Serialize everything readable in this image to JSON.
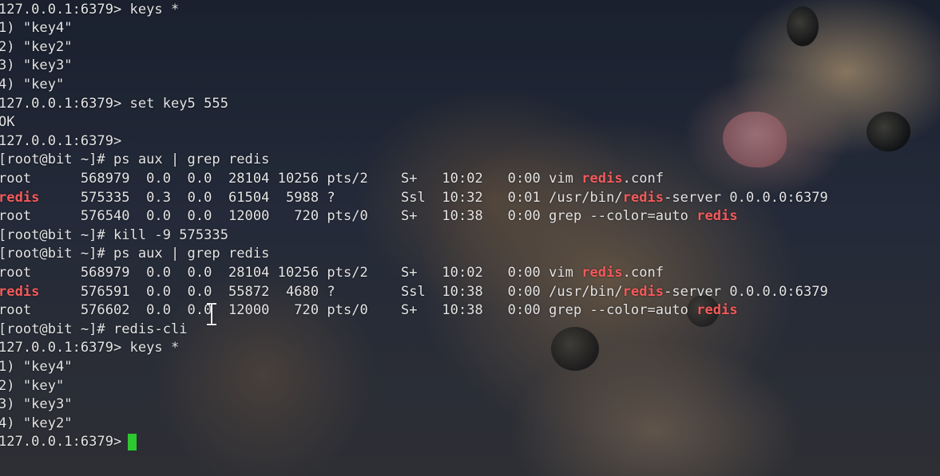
{
  "terminal": {
    "prompt_redis": "127.0.0.1:6379>",
    "prompt_shell": "[root@bit ~]#",
    "colors": {
      "text": "#e4e4e4",
      "match": "#f25a5a",
      "cursor": "#2ec830"
    },
    "lines": [
      {
        "parts": [
          {
            "t": "127.0.0.1:6379> keys *"
          }
        ]
      },
      {
        "parts": [
          {
            "t": "1) \"key4\""
          }
        ]
      },
      {
        "parts": [
          {
            "t": "2) \"key2\""
          }
        ]
      },
      {
        "parts": [
          {
            "t": "3) \"key3\""
          }
        ]
      },
      {
        "parts": [
          {
            "t": "4) \"key\""
          }
        ]
      },
      {
        "parts": [
          {
            "t": "127.0.0.1:6379> set key5 555"
          }
        ]
      },
      {
        "parts": [
          {
            "t": "OK"
          }
        ]
      },
      {
        "parts": [
          {
            "t": "127.0.0.1:6379>"
          }
        ]
      },
      {
        "parts": [
          {
            "t": "[root@bit ~]# ps aux | grep redis"
          }
        ]
      },
      {
        "parts": [
          {
            "t": "root      568979  0.0  0.0  28104 10256 pts/2    S+   10:02   0:00 vim "
          },
          {
            "t": "redis",
            "hl": true
          },
          {
            "t": ".conf"
          }
        ]
      },
      {
        "parts": [
          {
            "t": "redis",
            "hl": true
          },
          {
            "t": "     575335  0.3  0.0  61504  5988 ?        Ssl  10:32   0:01 /usr/bin/"
          },
          {
            "t": "redis",
            "hl": true
          },
          {
            "t": "-server 0.0.0.0:6379"
          }
        ]
      },
      {
        "parts": [
          {
            "t": "root      576540  0.0  0.0  12000   720 pts/0    S+   10:38   0:00 grep --color=auto "
          },
          {
            "t": "redis",
            "hl": true
          }
        ]
      },
      {
        "parts": [
          {
            "t": "[root@bit ~]# kill -9 575335"
          }
        ]
      },
      {
        "parts": [
          {
            "t": "[root@bit ~]# ps aux | grep redis"
          }
        ]
      },
      {
        "parts": [
          {
            "t": "root      568979  0.0  0.0  28104 10256 pts/2    S+   10:02   0:00 vim "
          },
          {
            "t": "redis",
            "hl": true
          },
          {
            "t": ".conf"
          }
        ]
      },
      {
        "parts": [
          {
            "t": "redis",
            "hl": true
          },
          {
            "t": "     576591  0.0  0.0  55872  4680 ?        Ssl  10:38   0:00 /usr/bin/"
          },
          {
            "t": "redis",
            "hl": true
          },
          {
            "t": "-server 0.0.0.0:6379"
          }
        ]
      },
      {
        "parts": [
          {
            "t": "root      576602  0.0  0.0  12000   720 pts/0    S+   10:38   0:00 grep --color=auto "
          },
          {
            "t": "redis",
            "hl": true
          }
        ]
      },
      {
        "parts": [
          {
            "t": "[root@bit ~]# redis-cli"
          }
        ]
      },
      {
        "parts": [
          {
            "t": "127.0.0.1:6379> keys *"
          }
        ]
      },
      {
        "parts": [
          {
            "t": "1) \"key4\""
          }
        ]
      },
      {
        "parts": [
          {
            "t": "2) \"key\""
          }
        ]
      },
      {
        "parts": [
          {
            "t": "3) \"key3\""
          }
        ]
      },
      {
        "parts": [
          {
            "t": "4) \"key2\""
          }
        ]
      },
      {
        "parts": [
          {
            "t": "127.0.0.1:6379> "
          }
        ]
      }
    ]
  },
  "icons": {
    "cursor": "text-cursor-icon",
    "caret": "terminal-caret"
  }
}
